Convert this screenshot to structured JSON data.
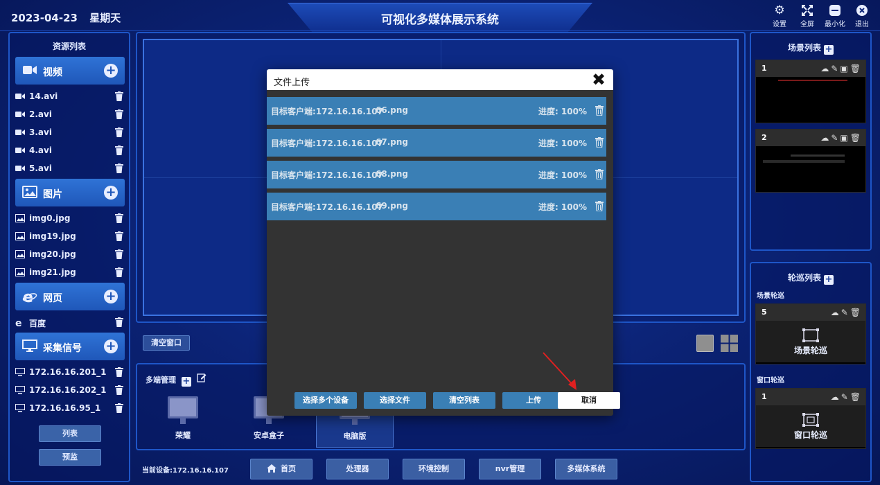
{
  "header": {
    "date": "2023-04-23",
    "weekday": "星期天",
    "title": "可视化多媒体展示系统",
    "controls": [
      {
        "label": "设置",
        "icon": "gear-icon"
      },
      {
        "label": "全屏",
        "icon": "fullscreen-icon"
      },
      {
        "label": "最小化",
        "icon": "minimize-icon"
      },
      {
        "label": "退出",
        "icon": "exit-icon"
      }
    ]
  },
  "resources": {
    "title": "资源列表",
    "video": {
      "label": "视频",
      "items": [
        "14.avi",
        "2.avi",
        "3.avi",
        "4.avi",
        "5.avi"
      ]
    },
    "image": {
      "label": "图片",
      "items": [
        "img0.jpg",
        "img19.jpg",
        "img20.jpg",
        "img21.jpg"
      ]
    },
    "web": {
      "label": "网页",
      "items": [
        "百度"
      ]
    },
    "capture": {
      "label": "采集信号",
      "items": [
        "172.16.16.201_1",
        "172.16.16.202_1",
        "172.16.16.95_1"
      ]
    },
    "list_button": "列表",
    "preview_button": "预监"
  },
  "stage": {
    "clear_button": "清空窗口"
  },
  "multi": {
    "title": "多端管理",
    "devices": [
      {
        "label": "荣耀",
        "active": false
      },
      {
        "label": "安卓盒子",
        "active": false
      },
      {
        "label": "电脑版",
        "active": true
      }
    ]
  },
  "footer": {
    "current_device": "当前设备:172.16.16.107",
    "nav": [
      "首页",
      "处理器",
      "环境控制",
      "nvr管理",
      "多媒体系统"
    ]
  },
  "scenes": {
    "title": "场景列表",
    "items": [
      {
        "num": "1"
      },
      {
        "num": "2"
      }
    ]
  },
  "tours": {
    "title": "轮巡列表",
    "scene_label": "场景轮巡",
    "scene_item": {
      "num": "5",
      "label": "场景轮巡"
    },
    "window_label": "窗口轮巡",
    "window_item": {
      "num": "1",
      "label": "窗口轮巡"
    }
  },
  "modal": {
    "title": "文件上传",
    "rows": [
      {
        "target": "目标客户端:172.16.16.107",
        "file": "66.png",
        "progress": "进度: 100%"
      },
      {
        "target": "目标客户端:172.16.16.107",
        "file": "67.png",
        "progress": "进度: 100%"
      },
      {
        "target": "目标客户端:172.16.16.107",
        "file": "68.png",
        "progress": "进度: 100%"
      },
      {
        "target": "目标客户端:172.16.16.107",
        "file": "69.png",
        "progress": "进度: 100%"
      }
    ],
    "buttons": {
      "select_devices": "选择多个设备",
      "select_file": "选择文件",
      "clear_list": "清空列表",
      "upload": "上传",
      "cancel": "取消"
    }
  },
  "colors": {
    "accent": "#3a7fb5",
    "panel_border": "#1e56c8",
    "annotation_arrow": "#e02020"
  }
}
